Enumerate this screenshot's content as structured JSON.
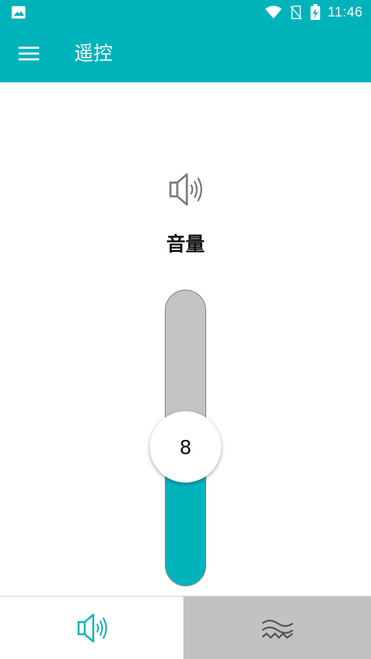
{
  "status_bar": {
    "time": "11:46",
    "icons": [
      "image-icon",
      "wifi-icon",
      "no-sim-icon",
      "battery-charging-icon"
    ]
  },
  "app_bar": {
    "title": "遥控",
    "menu_icon": "menu-icon"
  },
  "volume": {
    "label": "音量",
    "icon": "speaker-icon",
    "value": "8",
    "level_fraction": 0.47
  },
  "bottom_nav": {
    "tabs": [
      {
        "icon": "speaker-icon",
        "selected": true
      },
      {
        "icon": "waves-icon",
        "selected": false
      }
    ]
  },
  "colors": {
    "accent": "#00b3ba",
    "track": "#c4c4c4",
    "inactive_tab": "#c2c2c2"
  }
}
